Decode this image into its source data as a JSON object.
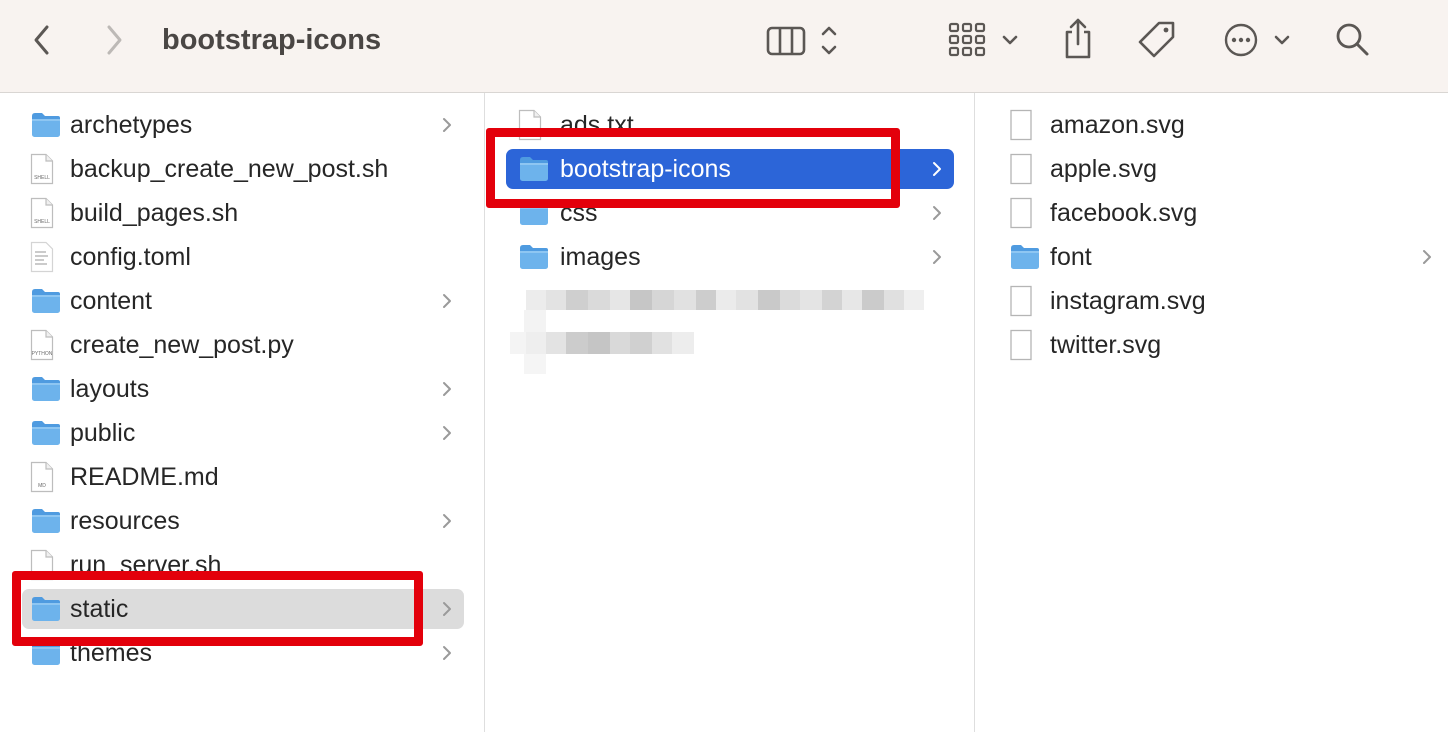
{
  "window": {
    "title": "bootstrap-icons"
  },
  "toolbar": {
    "back": "back-icon",
    "forward": "forward-icon",
    "view": "columns-view-icon",
    "group": "icon-grid-icon",
    "share": "share-icon",
    "tags": "tag-icon",
    "more": "more-icon",
    "search": "search-icon"
  },
  "columns": [
    {
      "items": [
        {
          "label": "archetypes",
          "kind": "folder",
          "chevron": true
        },
        {
          "label": "backup_create_new_post.sh",
          "kind": "file",
          "badge": "SHELL",
          "chevron": false
        },
        {
          "label": "build_pages.sh",
          "kind": "file",
          "badge": "SHELL",
          "chevron": false
        },
        {
          "label": "config.toml",
          "kind": "text",
          "badge": "",
          "chevron": false
        },
        {
          "label": "content",
          "kind": "folder",
          "chevron": true
        },
        {
          "label": "create_new_post.py",
          "kind": "file",
          "badge": "PYTHON",
          "chevron": false
        },
        {
          "label": "layouts",
          "kind": "folder",
          "chevron": true
        },
        {
          "label": "public",
          "kind": "folder",
          "chevron": true
        },
        {
          "label": "README.md",
          "kind": "file",
          "badge": "MD",
          "chevron": false
        },
        {
          "label": "resources",
          "kind": "folder",
          "chevron": true
        },
        {
          "label": "run_server.sh",
          "kind": "file",
          "badge": "SHELL",
          "chevron": false
        },
        {
          "label": "static",
          "kind": "folder",
          "chevron": true,
          "selected": "gray"
        },
        {
          "label": "themes",
          "kind": "folder",
          "chevron": true
        }
      ]
    },
    {
      "items": [
        {
          "label": "ads.txt",
          "kind": "file",
          "badge": "",
          "chevron": false
        },
        {
          "label": "bootstrap-icons",
          "kind": "folder",
          "chevron": true,
          "selected": "blue"
        },
        {
          "label": "css",
          "kind": "folder",
          "chevron": true
        },
        {
          "label": "images",
          "kind": "folder",
          "chevron": true
        }
      ]
    },
    {
      "items": [
        {
          "label": "amazon.svg",
          "kind": "file",
          "badge": "",
          "chevron": false
        },
        {
          "label": "apple.svg",
          "kind": "file",
          "badge": "",
          "chevron": false
        },
        {
          "label": "facebook.svg",
          "kind": "file",
          "badge": "",
          "chevron": false
        },
        {
          "label": "font",
          "kind": "folder",
          "chevron": true
        },
        {
          "label": "instagram.svg",
          "kind": "file",
          "badge": "",
          "chevron": false
        },
        {
          "label": "twitter.svg",
          "kind": "file",
          "badge": "",
          "chevron": false
        }
      ]
    }
  ],
  "colors": {
    "highlight": "#e3000b",
    "selection_blue": "#2c65d8",
    "selection_gray": "#dcdcdc",
    "folder": "#6db3ec"
  }
}
